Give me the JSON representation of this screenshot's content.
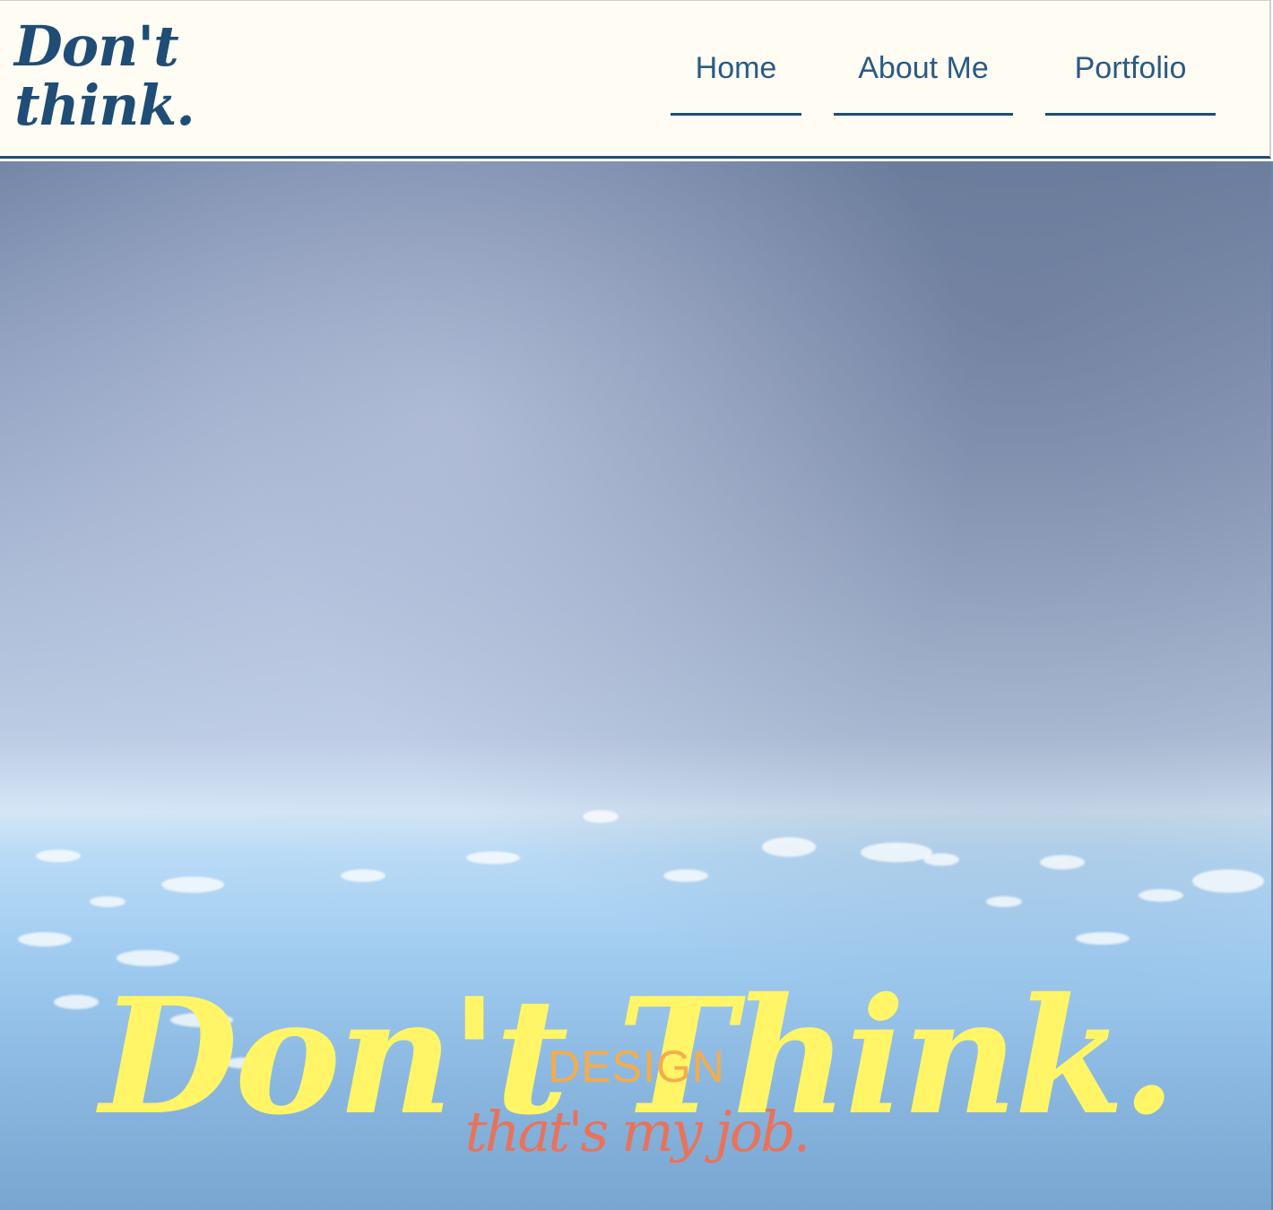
{
  "header": {
    "logo_line1": "Don't",
    "logo_line2": "think.",
    "nav": [
      {
        "label": "Home"
      },
      {
        "label": "About Me"
      },
      {
        "label": "Portfolio"
      }
    ]
  },
  "hero": {
    "title": "Don't Think.",
    "subtitle": "DESIGN",
    "tagline": "that's my job."
  },
  "colors": {
    "brand_navy": "#1f4d75",
    "header_bg": "#fffcf3",
    "hero_title": "#fff566",
    "hero_subtitle": "#f6ac4b",
    "hero_tagline": "#e8735c"
  }
}
